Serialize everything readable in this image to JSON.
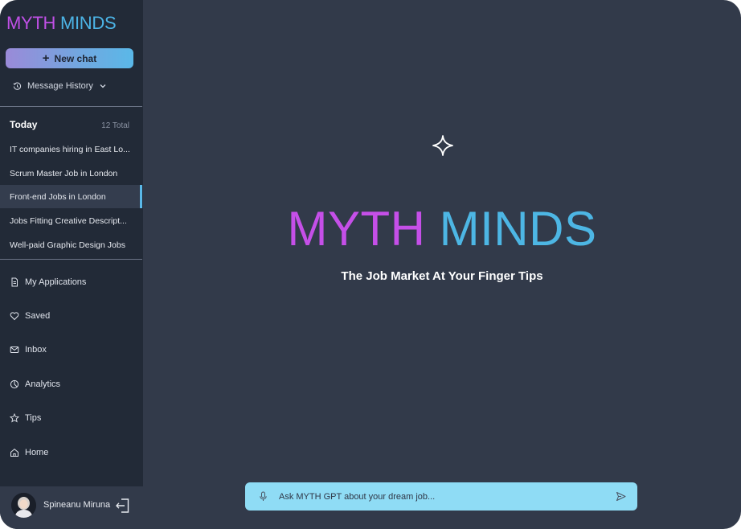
{
  "brand": {
    "part1": "MYTH",
    "part2": "MINDS",
    "color1": "#c050e6",
    "color2": "#4cb4e6"
  },
  "sidebar": {
    "new_chat_label": "New chat",
    "message_history_label": "Message History",
    "today_label": "Today",
    "total_label": "12 Total",
    "history": [
      {
        "label": "IT companies hiring in East Lo..."
      },
      {
        "label": "Scrum Master Job in London"
      },
      {
        "label": "Front-end Jobs in London",
        "active": true
      },
      {
        "label": "Jobs Fitting Creative Descript..."
      },
      {
        "label": "Well-paid Graphic Design Jobs"
      }
    ],
    "nav": [
      {
        "label": "My Applications",
        "icon": "document-icon"
      },
      {
        "label": "Saved",
        "icon": "heart-icon"
      },
      {
        "label": "Inbox",
        "icon": "mail-icon"
      },
      {
        "label": "Analytics",
        "icon": "pie-chart-icon"
      },
      {
        "label": "Tips",
        "icon": "star-icon"
      },
      {
        "label": "Home",
        "icon": "home-icon"
      }
    ],
    "user": {
      "name": "Spineanu Miruna"
    }
  },
  "main": {
    "title_part1": "MYTH",
    "title_part2": "MINDS",
    "subtitle": "The Job Market At Your Finger Tips",
    "chat_placeholder": "Ask MYTH GPT about your dream job..."
  },
  "colors": {
    "sidebar_bg": "#222a37",
    "main_bg": "#323a4a",
    "accent_blue": "#5ab8e8",
    "accent_purple": "#c54fe8",
    "chat_bar": "#8fdcf5"
  }
}
